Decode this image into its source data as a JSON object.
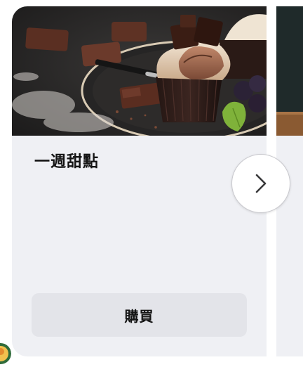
{
  "carousel": {
    "cards": [
      {
        "title": "一週甜點",
        "image_alt": "chocolate-cupcake-photo",
        "buy_label": "購買"
      }
    ],
    "next_icon": "chevron-right-icon"
  },
  "colors": {
    "card_background": "#eff0f4",
    "button_background": "#e3e4e9",
    "text_primary": "#141414"
  }
}
